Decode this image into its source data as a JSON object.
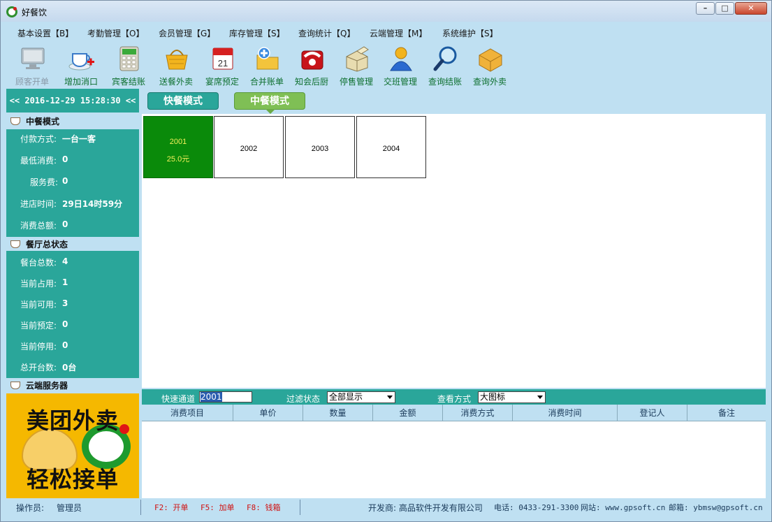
{
  "window": {
    "title": "好餐饮",
    "minimize": "–",
    "maximize": "□",
    "close": "✕"
  },
  "menu": [
    "基本设置【B】",
    "考勤管理【O】",
    "会员管理【G】",
    "库存管理【S】",
    "查询统计【Q】",
    "云端管理【M】",
    "系统维护【S】"
  ],
  "toolbar": [
    {
      "label": "顾客开单",
      "icon": "monitor-icon",
      "enabled": false
    },
    {
      "label": "增加消口",
      "icon": "cup-add-icon",
      "enabled": true
    },
    {
      "label": "宾客结账",
      "icon": "calculator-icon",
      "enabled": true
    },
    {
      "label": "送餐外卖",
      "icon": "basket-icon",
      "enabled": true
    },
    {
      "label": "宴席预定",
      "icon": "calendar-icon",
      "enabled": true
    },
    {
      "label": "合并账单",
      "icon": "folder-add-icon",
      "enabled": true
    },
    {
      "label": "知会后厨",
      "icon": "phone-icon",
      "enabled": true
    },
    {
      "label": "停售管理",
      "icon": "box-icon",
      "enabled": true
    },
    {
      "label": "交班管理",
      "icon": "user-icon",
      "enabled": true
    },
    {
      "label": "查询结账",
      "icon": "magnifier-icon",
      "enabled": true
    },
    {
      "label": "查询外卖",
      "icon": "package-icon",
      "enabled": true
    }
  ],
  "clock": "<< 2016-12-29 15:28:30 <<",
  "mode_section": {
    "title": "中餐模式",
    "rows": [
      {
        "key": "付款方式:",
        "value": "一台一客"
      },
      {
        "key": "最低消费:",
        "value": "0"
      },
      {
        "key": "服务费:",
        "value": "0"
      },
      {
        "key": "进店时间:",
        "value": "29日14时59分"
      },
      {
        "key": "消费总额:",
        "value": "0"
      }
    ]
  },
  "status_section": {
    "title": "餐厅总状态",
    "rows": [
      {
        "key": "餐台总数:",
        "value": "4"
      },
      {
        "key": "当前占用:",
        "value": "1"
      },
      {
        "key": "当前可用:",
        "value": "3"
      },
      {
        "key": "当前预定:",
        "value": "0"
      },
      {
        "key": "当前停用:",
        "value": "0"
      },
      {
        "key": "总开台数:",
        "value": "0台"
      }
    ]
  },
  "cloud_section": {
    "title": "云端服务器"
  },
  "ad": {
    "line1": "美团外卖",
    "line2": "轻松接单"
  },
  "modes": {
    "fast": "快餐模式",
    "mid": "中餐模式"
  },
  "tables": [
    {
      "number": "2001",
      "amount": "25.0元",
      "occupied": true
    },
    {
      "number": "2002",
      "amount": "",
      "occupied": false
    },
    {
      "number": "2003",
      "amount": "",
      "occupied": false
    },
    {
      "number": "2004",
      "amount": "",
      "occupied": false
    }
  ],
  "filter": {
    "quick_label": "快速通道",
    "quick_value": "2001",
    "status_label": "过滤状态",
    "status_value": "全部显示",
    "view_label": "查看方式",
    "view_value": "大图标"
  },
  "grid_columns": [
    "消费项目",
    "单价",
    "数量",
    "金额",
    "消费方式",
    "消费时间",
    "登记人",
    "备注"
  ],
  "statusbar": {
    "operator_label": "操作员:",
    "operator": "管理员",
    "keys": [
      "F2: 开单",
      "F5: 加单",
      "F8: 钱箱"
    ],
    "developer": "开发商: 高品软件开发有限公司",
    "phone": "电话: 0433-291-3300",
    "website": "网站: www.gpsoft.cn",
    "email": "邮箱: ybmsw@gpsoft.cn"
  },
  "colors": {
    "teal": "#2aa69a",
    "occupied": "#0a8a0a",
    "bg": "#bfe0f2",
    "accent_green": "#7fbf55"
  }
}
